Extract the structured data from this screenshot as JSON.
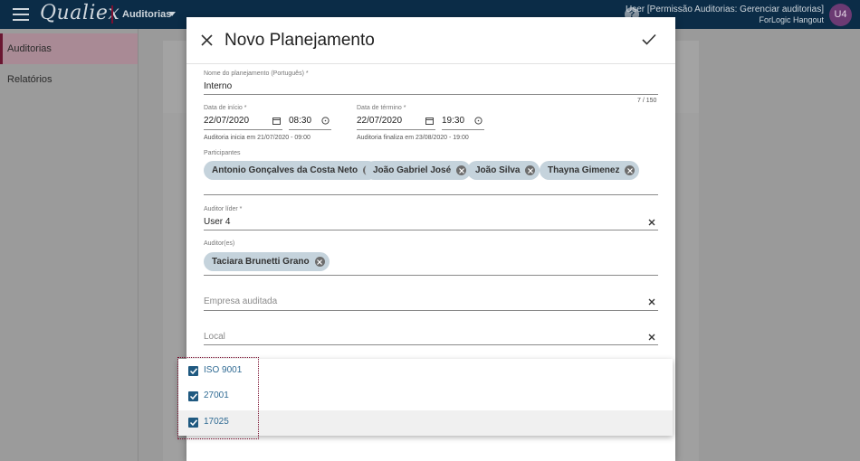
{
  "appbar": {
    "logo": "Qualiex",
    "module": "Auditorias",
    "help": "?",
    "user_name": "User [Permissão Auditorias: Gerenciar auditorias]",
    "user_org": "ForLogic Hangout",
    "avatar": "U4"
  },
  "sidebar": {
    "items": [
      {
        "label": "Auditorias"
      },
      {
        "label": "Relatórios"
      }
    ]
  },
  "dialog": {
    "title": "Novo Planejamento",
    "plan_name": {
      "label": "Nome do planejamento (Português) *",
      "value": "Interno",
      "counter": "7 / 150"
    },
    "start": {
      "label": "Data de início *",
      "date": "22/07/2020",
      "time": "08:30",
      "hint": "Auditoria inicia em 21/07/2020 - 09:00"
    },
    "end": {
      "label": "Data de término *",
      "date": "22/07/2020",
      "time": "19:30",
      "hint": "Auditoria finaliza em 23/08/2020 - 19:00"
    },
    "participants": {
      "label": "Participantes",
      "chips": [
        "Antonio Gonçalves da Costa Neto",
        "João Gabriel José",
        "João Silva",
        "Thayna Gimenez"
      ]
    },
    "lead_auditor": {
      "label": "Auditor líder *",
      "value": "User 4"
    },
    "auditors": {
      "label": "Auditor(es)",
      "chips": [
        "Taciara Brunetti Grano"
      ]
    },
    "company": {
      "placeholder": "Empresa auditada"
    },
    "location": {
      "placeholder": "Local"
    }
  },
  "dropdown": {
    "options": [
      {
        "label": "ISO 9001",
        "checked": true
      },
      {
        "label": "27001",
        "checked": true
      },
      {
        "label": "17025",
        "checked": true
      }
    ]
  },
  "colors": {
    "appbar": "#0b2c47",
    "accent": "#6a1631",
    "chip": "#c5d3dc",
    "checkbox": "#1f5980"
  }
}
